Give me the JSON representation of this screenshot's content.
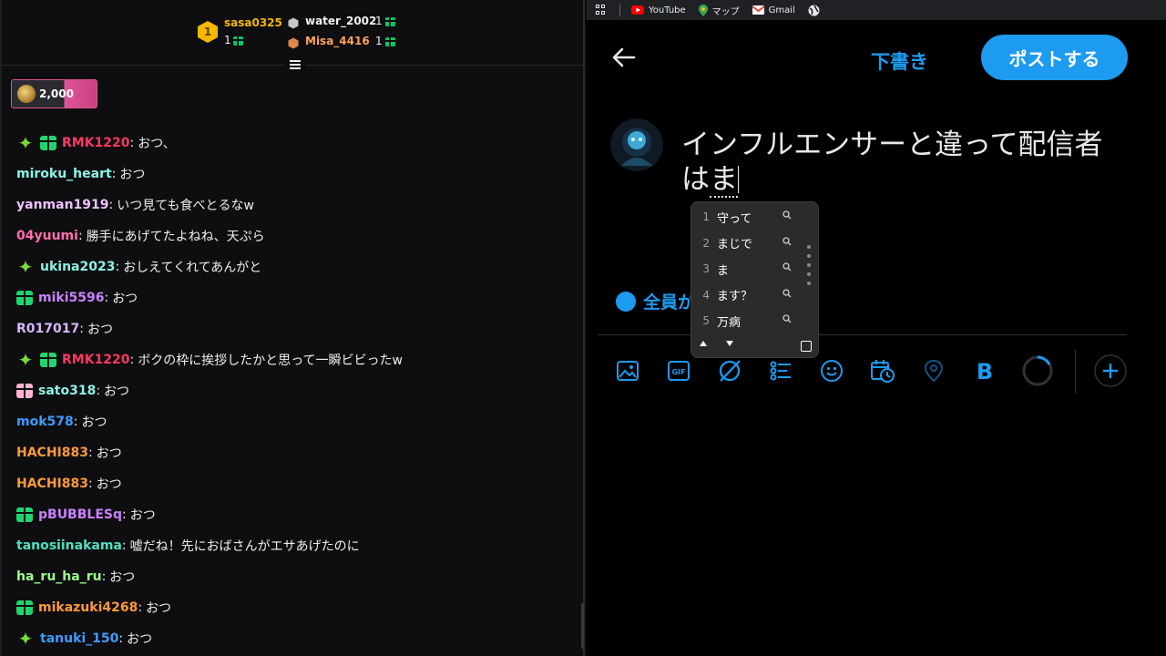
{
  "leaderboard": {
    "first": {
      "rank": "1",
      "name": "sasa0325",
      "count": "1"
    },
    "second": {
      "name": "water_2002",
      "count": "1"
    },
    "third": {
      "name": "Misa_4416",
      "count": "1"
    }
  },
  "points": {
    "value": "2,000"
  },
  "messages": [
    {
      "badges": [
        "spark",
        "gift-green"
      ],
      "user": "RMK1220",
      "color": "#ff3860",
      "text": "おつ、"
    },
    {
      "badges": [],
      "user": "miroku_heart",
      "color": "#8cf2e6",
      "text": "おつ"
    },
    {
      "badges": [],
      "user": "yanman1919",
      "color": "#f0c2ff",
      "text": "いつ見ても食べとるなw"
    },
    {
      "badges": [],
      "user": "04yuumi",
      "color": "#ff6fae",
      "text": "勝手にあげてたよねね、天ぷら"
    },
    {
      "badges": [
        "spark"
      ],
      "user": "ukina2023",
      "color": "#8cf2e6",
      "text": "おしえてくれてあんがと"
    },
    {
      "badges": [
        "gift-green"
      ],
      "user": "miki5596",
      "color": "#c883ff",
      "text": "おつ"
    },
    {
      "badges": [],
      "user": "R017017",
      "color": "#d9b6ff",
      "text": "おつ"
    },
    {
      "badges": [
        "spark",
        "gift-green"
      ],
      "user": "RMK1220",
      "color": "#ff3860",
      "text": "ボクの枠に挨拶したかと思って一瞬ビビったw"
    },
    {
      "badges": [
        "gift-pink"
      ],
      "user": "sato318",
      "color": "#8cf2e6",
      "text": "おつ"
    },
    {
      "badges": [],
      "user": "mok578",
      "color": "#3f9bff",
      "text": "おつ"
    },
    {
      "badges": [],
      "user": "HACHI883",
      "color": "#ff9a3c",
      "text": "おつ"
    },
    {
      "badges": [],
      "user": "HACHI883",
      "color": "#ff9a3c",
      "text": "おつ"
    },
    {
      "badges": [
        "gift-green"
      ],
      "user": "pBUBBLESq",
      "color": "#c883ff",
      "text": "おつ"
    },
    {
      "badges": [],
      "user": "tanosiinakama",
      "color": "#4fe0c0",
      "text": "嘘だね！先におばさんがエサあげたのに"
    },
    {
      "badges": [],
      "user": "ha_ru_ha_ru",
      "color": "#9dff8a",
      "text": "おつ"
    },
    {
      "badges": [
        "gift-green"
      ],
      "user": "mikazuki4268",
      "color": "#ff9a3c",
      "text": "おつ"
    },
    {
      "badges": [
        "spark"
      ],
      "user": "tanuki_150",
      "color": "#3f9bff",
      "text": "おつ"
    }
  ],
  "bookmarks": [
    {
      "label": "YouTube",
      "icon": "youtube-icon"
    },
    {
      "label": "マップ",
      "icon": "maps-icon"
    },
    {
      "label": "Gmail",
      "icon": "gmail-icon"
    }
  ],
  "compose": {
    "draft_label": "下書き",
    "post_label": "ポストする",
    "text_main": "インフルエンサーと違って配信者",
    "text_committed": "は",
    "text_composing": "ま",
    "reply_label": "全員が"
  },
  "ime": {
    "candidates": [
      {
        "n": "1",
        "w": "守って"
      },
      {
        "n": "2",
        "w": "まじで"
      },
      {
        "n": "3",
        "w": "ま"
      },
      {
        "n": "4",
        "w": "ます？"
      },
      {
        "n": "5",
        "w": "万病"
      }
    ]
  },
  "colors": {
    "accent": "#1d9bf0",
    "gold": "#f5b800"
  }
}
